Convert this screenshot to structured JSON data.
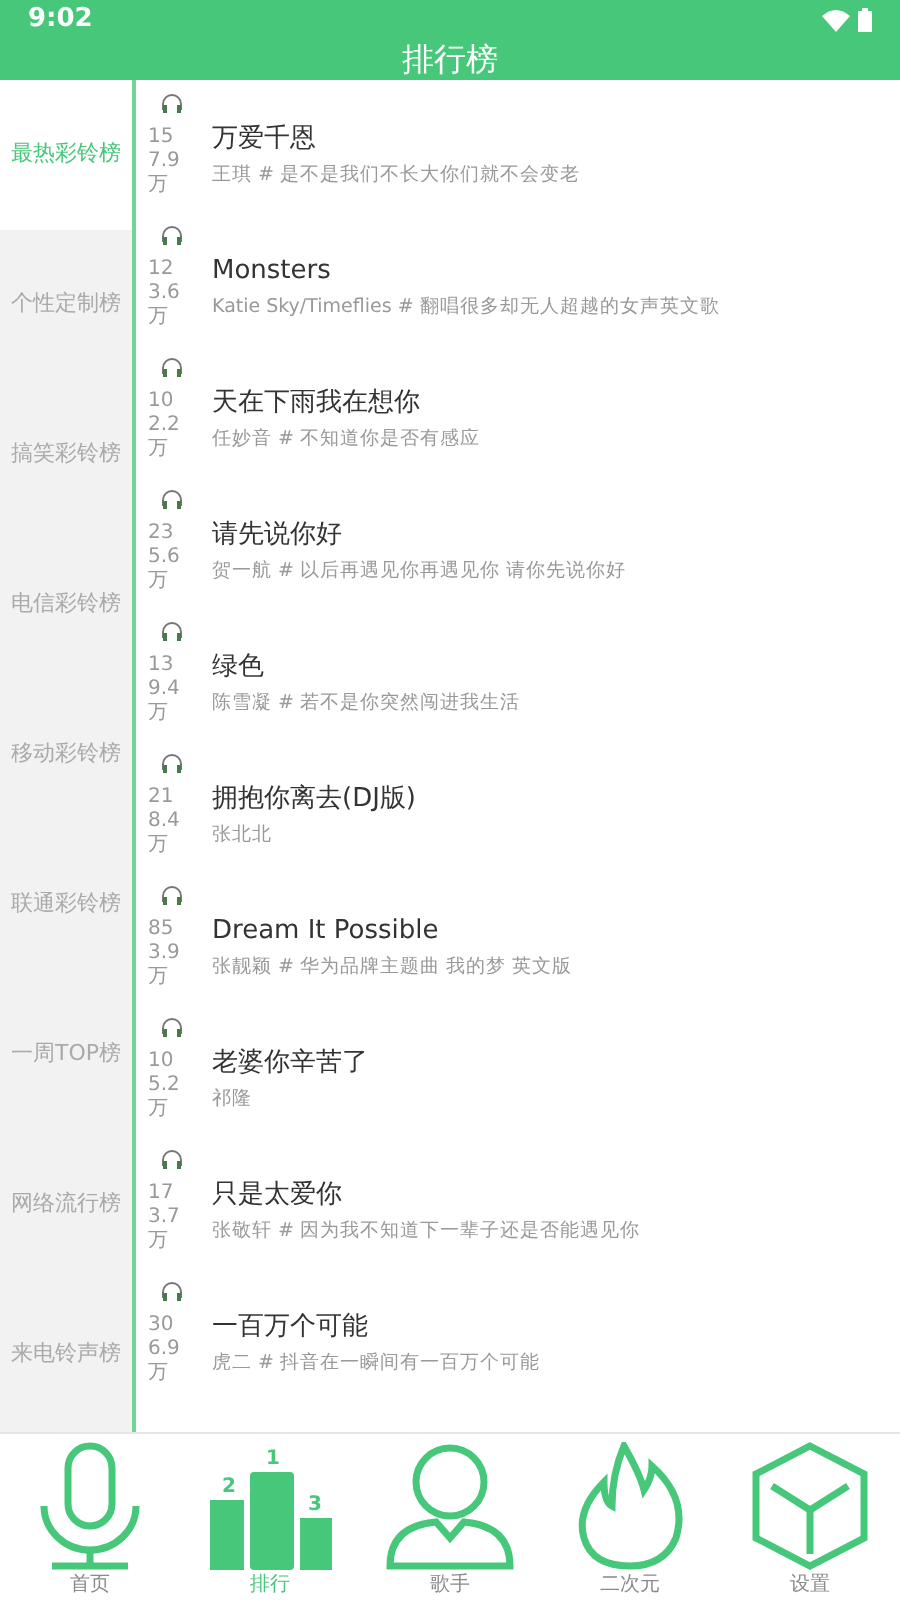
{
  "status_bar": {
    "time": "9:02"
  },
  "title": "排行榜",
  "categories": [
    {
      "label": "最热彩铃榜",
      "selected": true
    },
    {
      "label": "个性定制榜",
      "selected": false
    },
    {
      "label": "搞笑彩铃榜",
      "selected": false
    },
    {
      "label": "电信彩铃榜",
      "selected": false
    },
    {
      "label": "移动彩铃榜",
      "selected": false
    },
    {
      "label": "联通彩铃榜",
      "selected": false
    },
    {
      "label": "一周TOP榜",
      "selected": false
    },
    {
      "label": "网络流行榜",
      "selected": false
    },
    {
      "label": "来电铃声榜",
      "selected": false
    }
  ],
  "songs": [
    {
      "plays": [
        "15",
        "7.9",
        "万"
      ],
      "title": "万爱千恩",
      "subtitle": "王琪 # 是不是我们不长大你们就不会变老"
    },
    {
      "plays": [
        "12",
        "3.6",
        "万"
      ],
      "title": "Monsters",
      "subtitle": "Katie Sky/Timeflies # 翻唱很多却无人超越的女声英文歌"
    },
    {
      "plays": [
        "10",
        "2.2",
        "万"
      ],
      "title": "天在下雨我在想你",
      "subtitle": "任妙音 # 不知道你是否有感应"
    },
    {
      "plays": [
        "23",
        "5.6",
        "万"
      ],
      "title": "请先说你好",
      "subtitle": "贺一航 # 以后再遇见你再遇见你 请你先说你好"
    },
    {
      "plays": [
        "13",
        "9.4",
        "万"
      ],
      "title": "绿色",
      "subtitle": "陈雪凝 # 若不是你突然闯进我生活"
    },
    {
      "plays": [
        "21",
        "8.4",
        "万"
      ],
      "title": "拥抱你离去(DJ版)",
      "subtitle": "张北北"
    },
    {
      "plays": [
        "85",
        "3.9",
        "万"
      ],
      "title": "Dream It Possible",
      "subtitle": "张靓颖 # 华为品牌主题曲 我的梦 英文版"
    },
    {
      "plays": [
        "10",
        "5.2",
        "万"
      ],
      "title": "老婆你辛苦了",
      "subtitle": "祁隆"
    },
    {
      "plays": [
        "17",
        "3.7",
        "万"
      ],
      "title": "只是太爱你",
      "subtitle": "张敬轩 # 因为我不知道下一辈子还是否能遇见你"
    },
    {
      "plays": [
        "30",
        "6.9",
        "万"
      ],
      "title": "一百万个可能",
      "subtitle": "虎二 # 抖音在一瞬间有一百万个可能"
    }
  ],
  "tab_bar": [
    {
      "kind": "mic",
      "label": "首页",
      "selected": false
    },
    {
      "kind": "podium",
      "label": "排行",
      "selected": true,
      "icon_labels": [
        "2",
        "1",
        "3"
      ]
    },
    {
      "kind": "person",
      "label": "歌手",
      "selected": false
    },
    {
      "kind": "flame",
      "label": "二次元",
      "selected": false
    },
    {
      "kind": "cube",
      "label": "设置",
      "selected": false
    }
  ]
}
